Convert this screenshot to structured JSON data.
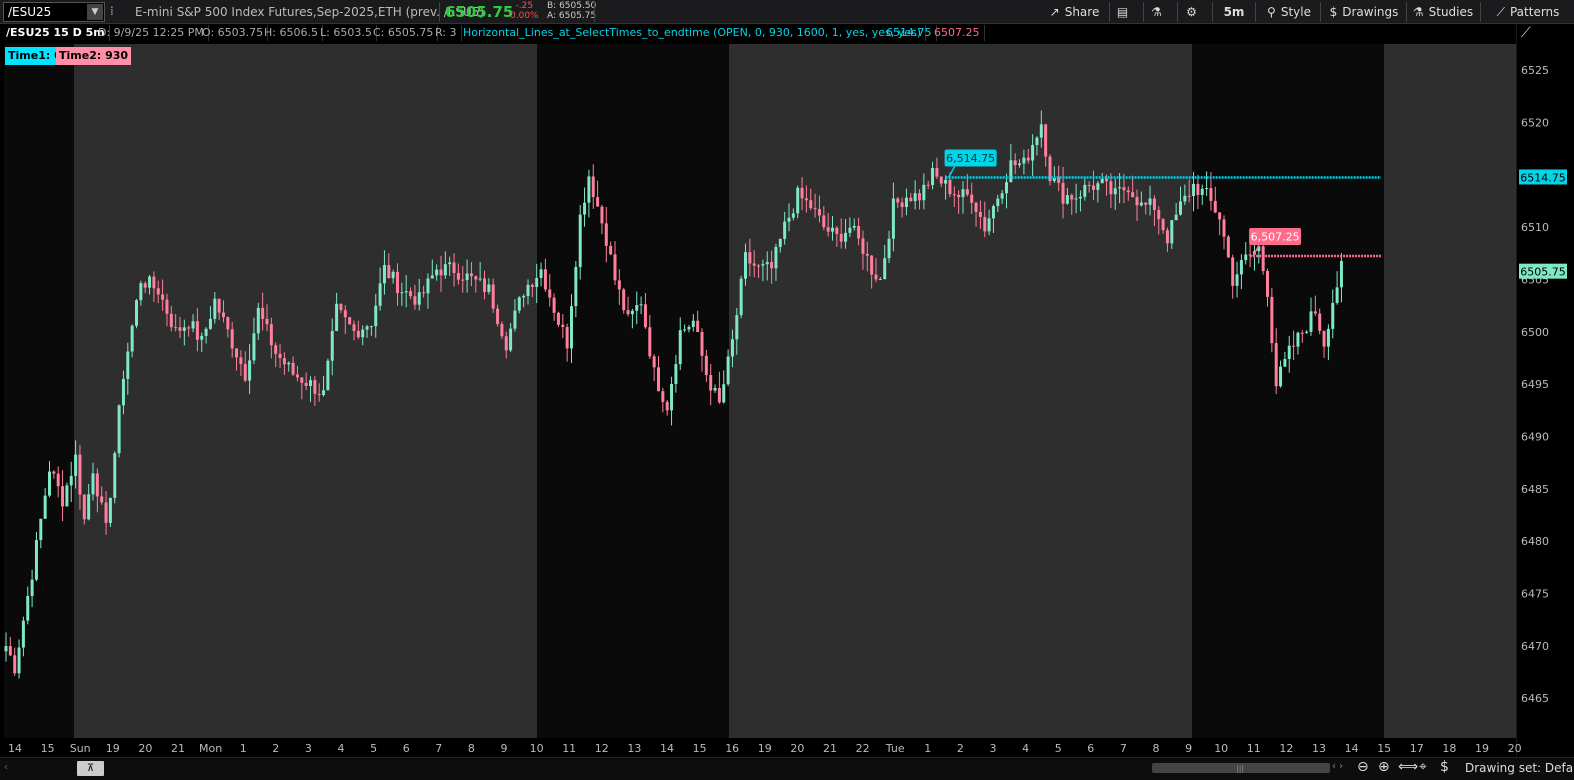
{
  "colors": {
    "bull": "#7ee8c8",
    "bear": "#ff7f9c",
    "line1": "#00d5e8",
    "line2": "#ff6b8b",
    "session_dark": "#0a0a0a",
    "session_light": "#2e2e2e",
    "axis_text": "#bbbbbb"
  },
  "header": {
    "symbol": "/ESU25",
    "description": "E-mini S&P 500 Index Futures,Sep-2025,ETH (prev. /ESU5)",
    "last": "6505.75",
    "change": "-.25",
    "change_pct": "0.00%",
    "bid": "B: 6505.50",
    "ask": "A: 6505.75",
    "timeframe": "5m",
    "share": "Share",
    "style": "Style",
    "drawings": "Drawings",
    "studies": "Studies",
    "patterns": "Patterns"
  },
  "legend": {
    "title": "/ESU25 15 D 5m",
    "date": "D: 9/9/25 12:25 PM",
    "open": "O: 6503.75",
    "high": "H: 6506.5",
    "low": "L: 6503.5",
    "close": "C: 6505.75",
    "range": "R: 3",
    "study": "Horizontal_Lines_at_SelectTimes_to_endtime (OPEN, 0, 930, 1600, 1, yes, yes, yes)",
    "study_v1": "6514.75",
    "study_v2": "6507.25",
    "time1": "Time1: 0",
    "time2": "Time2: 930"
  },
  "chart_data": {
    "type": "candlestick",
    "y_ticks": [
      6465,
      6470,
      6475,
      6480,
      6485,
      6490,
      6495,
      6500,
      6505,
      6510,
      6515,
      6520,
      6525
    ],
    "ylim": [
      6461.2,
      6527.5
    ],
    "x_ticks": [
      "14",
      "15",
      "Sun",
      "19",
      "20",
      "21",
      "Mon",
      "1",
      "2",
      "3",
      "4",
      "5",
      "6",
      "7",
      "8",
      "9",
      "10",
      "11",
      "12",
      "13",
      "14",
      "15",
      "16",
      "19",
      "20",
      "21",
      "22",
      "Tue",
      "1",
      "2",
      "3",
      "4",
      "5",
      "6",
      "7",
      "8",
      "9",
      "10",
      "11",
      "12",
      "13",
      "14",
      "15",
      "17",
      "18",
      "19",
      "20"
    ],
    "path": [
      [
        0,
        6470
      ],
      [
        2,
        6468
      ],
      [
        6,
        6477
      ],
      [
        10,
        6487
      ],
      [
        13,
        6484
      ],
      [
        16,
        6488
      ],
      [
        18,
        6482
      ],
      [
        20,
        6487
      ],
      [
        23,
        6481
      ],
      [
        27,
        6496
      ],
      [
        31,
        6505
      ],
      [
        35,
        6504
      ],
      [
        39,
        6500
      ],
      [
        42,
        6501
      ],
      [
        45,
        6499
      ],
      [
        48,
        6503
      ],
      [
        51,
        6500
      ],
      [
        55,
        6496
      ],
      [
        58,
        6502
      ],
      [
        62,
        6498
      ],
      [
        66,
        6496
      ],
      [
        70,
        6495
      ],
      [
        73,
        6494
      ],
      [
        76,
        6502
      ],
      [
        80,
        6500
      ],
      [
        84,
        6501
      ],
      [
        87,
        6506
      ],
      [
        91,
        6504
      ],
      [
        95,
        6503
      ],
      [
        99,
        6506
      ],
      [
        103,
        6506
      ],
      [
        107,
        6505
      ],
      [
        111,
        6504
      ],
      [
        115,
        6499
      ],
      [
        119,
        6504
      ],
      [
        123,
        6506
      ],
      [
        127,
        6501
      ],
      [
        129,
        6499
      ],
      [
        132,
        6511
      ],
      [
        134,
        6515
      ],
      [
        136,
        6512
      ],
      [
        138,
        6509
      ],
      [
        140,
        6505
      ],
      [
        143,
        6501
      ],
      [
        146,
        6503
      ],
      [
        149,
        6496
      ],
      [
        152,
        6493
      ],
      [
        155,
        6500
      ],
      [
        158,
        6501
      ],
      [
        161,
        6496
      ],
      [
        164,
        6493
      ],
      [
        167,
        6499
      ],
      [
        170,
        6507
      ],
      [
        173,
        6506
      ],
      [
        176,
        6506
      ],
      [
        179,
        6510
      ],
      [
        182,
        6513
      ],
      [
        185,
        6512
      ],
      [
        188,
        6510
      ],
      [
        191,
        6509
      ],
      [
        194,
        6510
      ],
      [
        197,
        6508
      ],
      [
        199,
        6506
      ],
      [
        201,
        6505
      ],
      [
        204,
        6512
      ],
      [
        207,
        6513
      ],
      [
        210,
        6513
      ],
      [
        213,
        6515
      ],
      [
        216,
        6514
      ],
      [
        219,
        6513
      ],
      [
        222,
        6513
      ],
      [
        225,
        6510
      ],
      [
        228,
        6513
      ],
      [
        231,
        6516
      ],
      [
        234,
        6516
      ],
      [
        236,
        6518
      ],
      [
        238,
        6520
      ],
      [
        240,
        6515
      ],
      [
        243,
        6513
      ],
      [
        246,
        6513
      ],
      [
        249,
        6514
      ],
      [
        252,
        6514
      ],
      [
        255,
        6513
      ],
      [
        258,
        6514
      ],
      [
        261,
        6512
      ],
      [
        264,
        6512
      ],
      [
        267,
        6509
      ],
      [
        270,
        6512
      ],
      [
        273,
        6514
      ],
      [
        276,
        6513
      ],
      [
        279,
        6511
      ],
      [
        282,
        6505
      ],
      [
        285,
        6507
      ],
      [
        288,
        6508
      ],
      [
        290,
        6504
      ],
      [
        292,
        6495
      ],
      [
        295,
        6498
      ],
      [
        298,
        6500
      ],
      [
        301,
        6502
      ],
      [
        303,
        6499
      ],
      [
        305,
        6503
      ],
      [
        307,
        6506
      ]
    ],
    "bars_per_tick": 24.63,
    "x_tick_step": 32.6,
    "hlines": [
      {
        "price": 6514.75,
        "label": "6,514.75",
        "start_bar": 216
      },
      {
        "price": 6507.25,
        "label": "6,507.25",
        "start_bar": 286
      }
    ],
    "price_tags": [
      {
        "price": 6514.75,
        "label": "6514.75"
      },
      {
        "price": 6505.75,
        "label": "6505.75"
      }
    ]
  },
  "footer": {
    "drawing_set": "Drawing set: Default"
  }
}
